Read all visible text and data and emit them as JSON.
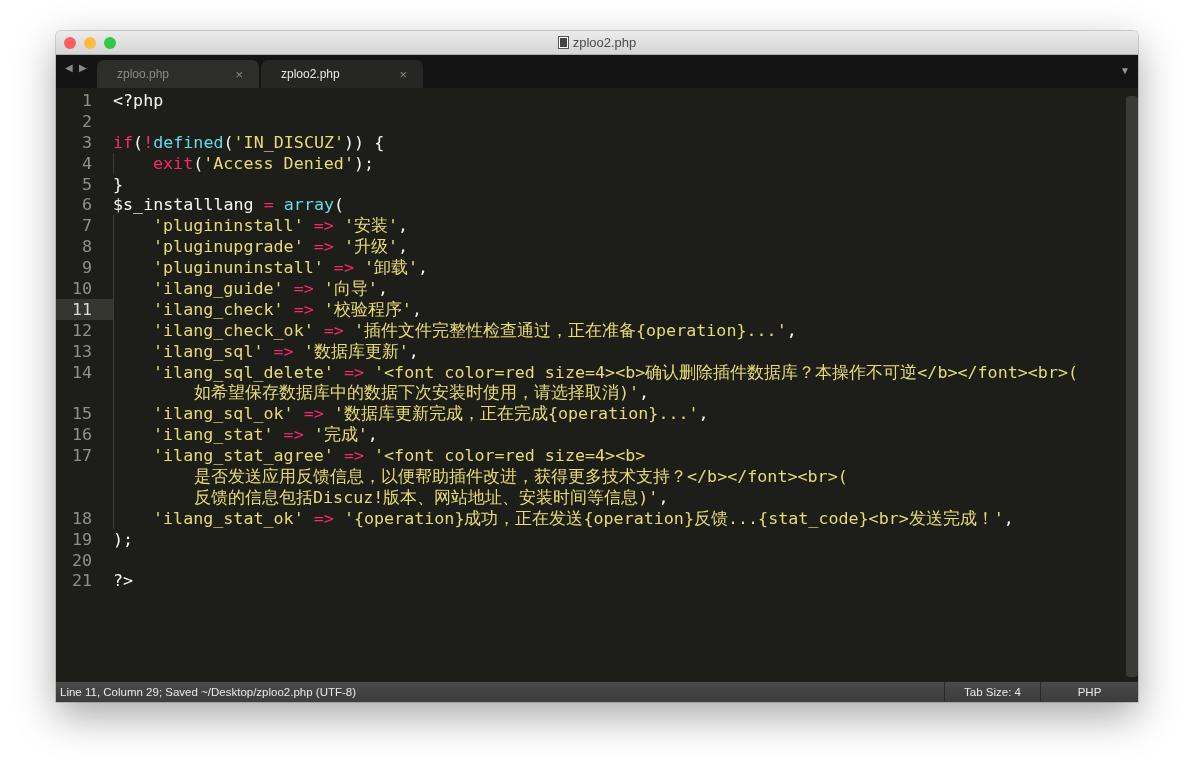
{
  "window": {
    "title": "zploo2.php"
  },
  "nav": {
    "back": "◀",
    "forward": "▶"
  },
  "tabs": [
    {
      "label": "zploo.php",
      "close": "×",
      "selected": false
    },
    {
      "label": "zploo2.php",
      "close": "×",
      "selected": true
    }
  ],
  "tab_menu": "▼",
  "lines": [
    {
      "number": "1",
      "selected": false,
      "rows": [
        {
          "kind": "top",
          "tokens": [
            {
              "kind": "plain",
              "text": "<?php"
            }
          ]
        }
      ]
    },
    {
      "number": "2",
      "selected": false,
      "rows": [
        {
          "kind": "top",
          "tokens": []
        }
      ]
    },
    {
      "number": "3",
      "selected": false,
      "rows": [
        {
          "kind": "top",
          "tokens": [
            {
              "kind": "keyword",
              "text": "if"
            },
            {
              "kind": "plain",
              "text": "("
            },
            {
              "kind": "keyword",
              "text": "!"
            },
            {
              "kind": "func",
              "text": "defined"
            },
            {
              "kind": "plain",
              "text": "("
            },
            {
              "kind": "string",
              "text": "'IN_DISCUZ'"
            },
            {
              "kind": "plain",
              "text": ")) {"
            }
          ]
        }
      ]
    },
    {
      "number": "4",
      "selected": false,
      "rows": [
        {
          "kind": "indent",
          "tokens": [
            {
              "kind": "keyword",
              "text": "exit"
            },
            {
              "kind": "plain",
              "text": "("
            },
            {
              "kind": "string",
              "text": "'Access Denied'"
            },
            {
              "kind": "plain",
              "text": ");"
            }
          ]
        }
      ]
    },
    {
      "number": "5",
      "selected": false,
      "rows": [
        {
          "kind": "top",
          "tokens": [
            {
              "kind": "plain",
              "text": "}"
            }
          ]
        }
      ]
    },
    {
      "number": "6",
      "selected": false,
      "rows": [
        {
          "kind": "top",
          "tokens": [
            {
              "kind": "plain",
              "text": "$s_installlang"
            },
            {
              "kind": "keyword",
              "text": " = "
            },
            {
              "kind": "func",
              "text": "array"
            },
            {
              "kind": "plain",
              "text": "("
            }
          ]
        }
      ]
    },
    {
      "number": "7",
      "selected": false,
      "rows": [
        {
          "kind": "indent",
          "tokens": [
            {
              "kind": "string",
              "text": "'plugininstall'"
            },
            {
              "kind": "keyword",
              "text": " => "
            },
            {
              "kind": "string",
              "text": "'安装'"
            },
            {
              "kind": "plain",
              "text": ","
            }
          ]
        }
      ]
    },
    {
      "number": "8",
      "selected": false,
      "rows": [
        {
          "kind": "indent",
          "tokens": [
            {
              "kind": "string",
              "text": "'pluginupgrade'"
            },
            {
              "kind": "keyword",
              "text": " => "
            },
            {
              "kind": "string",
              "text": "'升级'"
            },
            {
              "kind": "plain",
              "text": ","
            }
          ]
        }
      ]
    },
    {
      "number": "9",
      "selected": false,
      "rows": [
        {
          "kind": "indent",
          "tokens": [
            {
              "kind": "string",
              "text": "'pluginuninstall'"
            },
            {
              "kind": "keyword",
              "text": " => "
            },
            {
              "kind": "string",
              "text": "'卸载'"
            },
            {
              "kind": "plain",
              "text": ","
            }
          ]
        }
      ]
    },
    {
      "number": "10",
      "selected": false,
      "rows": [
        {
          "kind": "indent",
          "tokens": [
            {
              "kind": "string",
              "text": "'ilang_guide'"
            },
            {
              "kind": "keyword",
              "text": " => "
            },
            {
              "kind": "string",
              "text": "'向导'"
            },
            {
              "kind": "plain",
              "text": ","
            }
          ]
        }
      ]
    },
    {
      "number": "11",
      "selected": true,
      "rows": [
        {
          "kind": "indent",
          "tokens": [
            {
              "kind": "string",
              "text": "'ilang_check'"
            },
            {
              "kind": "keyword",
              "text": " => "
            },
            {
              "kind": "string",
              "text": "'校验程序'"
            },
            {
              "kind": "plain",
              "text": ","
            }
          ]
        }
      ]
    },
    {
      "number": "12",
      "selected": false,
      "rows": [
        {
          "kind": "indent",
          "tokens": [
            {
              "kind": "string",
              "text": "'ilang_check_ok'"
            },
            {
              "kind": "keyword",
              "text": " => "
            },
            {
              "kind": "string",
              "text": "'插件文件完整性检查通过，正在准备{operation}...'"
            },
            {
              "kind": "plain",
              "text": ","
            }
          ]
        }
      ]
    },
    {
      "number": "13",
      "selected": false,
      "rows": [
        {
          "kind": "indent",
          "tokens": [
            {
              "kind": "string",
              "text": "'ilang_sql'"
            },
            {
              "kind": "keyword",
              "text": " => "
            },
            {
              "kind": "string",
              "text": "'数据库更新'"
            },
            {
              "kind": "plain",
              "text": ","
            }
          ]
        }
      ]
    },
    {
      "number": "14",
      "selected": false,
      "rows": [
        {
          "kind": "indent",
          "tokens": [
            {
              "kind": "string",
              "text": "'ilang_sql_delete'"
            },
            {
              "kind": "keyword",
              "text": " => "
            },
            {
              "kind": "string",
              "text": "'<font color=red size=4><b>确认删除插件数据库？本操作不可逆</b></font><br>("
            }
          ]
        },
        {
          "kind": "wrap",
          "tokens": [
            {
              "kind": "string",
              "text": "如希望保存数据库中的数据下次安装时使用，请选择取消)'"
            },
            {
              "kind": "plain",
              "text": ","
            }
          ]
        }
      ]
    },
    {
      "number": "15",
      "selected": false,
      "rows": [
        {
          "kind": "indent",
          "tokens": [
            {
              "kind": "string",
              "text": "'ilang_sql_ok'"
            },
            {
              "kind": "keyword",
              "text": " => "
            },
            {
              "kind": "string",
              "text": "'数据库更新完成，正在完成{operation}...'"
            },
            {
              "kind": "plain",
              "text": ","
            }
          ]
        }
      ]
    },
    {
      "number": "16",
      "selected": false,
      "rows": [
        {
          "kind": "indent",
          "tokens": [
            {
              "kind": "string",
              "text": "'ilang_stat'"
            },
            {
              "kind": "keyword",
              "text": " => "
            },
            {
              "kind": "string",
              "text": "'完成'"
            },
            {
              "kind": "plain",
              "text": ","
            }
          ]
        }
      ]
    },
    {
      "number": "17",
      "selected": false,
      "rows": [
        {
          "kind": "indent",
          "tokens": [
            {
              "kind": "string",
              "text": "'ilang_stat_agree'"
            },
            {
              "kind": "keyword",
              "text": " => "
            },
            {
              "kind": "string",
              "text": "'<font color=red size=4><b>"
            }
          ]
        },
        {
          "kind": "wrap",
          "tokens": [
            {
              "kind": "string",
              "text": "是否发送应用反馈信息，以便帮助插件改进，获得更多技术支持？</b></font><br>("
            }
          ]
        },
        {
          "kind": "wrap",
          "tokens": [
            {
              "kind": "string",
              "text": "反馈的信息包括Discuz!版本、网站地址、安装时间等信息)'"
            },
            {
              "kind": "plain",
              "text": ","
            }
          ]
        }
      ]
    },
    {
      "number": "18",
      "selected": false,
      "rows": [
        {
          "kind": "indent",
          "tokens": [
            {
              "kind": "string",
              "text": "'ilang_stat_ok'"
            },
            {
              "kind": "keyword",
              "text": " => "
            },
            {
              "kind": "string",
              "text": "'{operation}成功，正在发送{operation}反馈...{stat_code}<br>发送完成！'"
            },
            {
              "kind": "plain",
              "text": ","
            }
          ]
        }
      ]
    },
    {
      "number": "19",
      "selected": false,
      "rows": [
        {
          "kind": "top",
          "tokens": [
            {
              "kind": "plain",
              "text": ");"
            }
          ]
        }
      ]
    },
    {
      "number": "20",
      "selected": false,
      "rows": [
        {
          "kind": "top",
          "tokens": []
        }
      ]
    },
    {
      "number": "21",
      "selected": false,
      "rows": [
        {
          "kind": "top",
          "tokens": [
            {
              "kind": "plain",
              "text": "?>"
            }
          ]
        }
      ]
    }
  ],
  "status_bar": {
    "position": "Line 11, Column 29; Saved ~/Desktop/zploo2.php (UTF-8)",
    "tab_size": "Tab Size: 4",
    "syntax": "PHP"
  }
}
